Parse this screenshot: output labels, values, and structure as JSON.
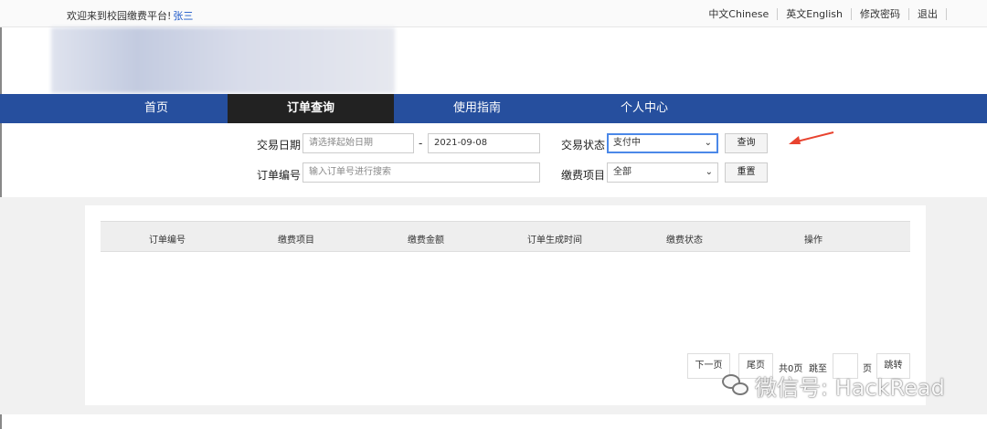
{
  "topbar": {
    "welcome": "欢迎来到校园缴费平台!",
    "username": "张三",
    "links": [
      "中文Chinese",
      "英文English",
      "修改密码",
      "退出"
    ]
  },
  "nav": {
    "items": [
      "首页",
      "订单查询",
      "使用指南",
      "个人中心"
    ],
    "active": "订单查询"
  },
  "search": {
    "date_label": "交易日期",
    "start_date_placeholder": "请选择起始日期",
    "date_separator": "-",
    "end_date_value": "2021-09-08",
    "status_label": "交易状态",
    "status_value": "支付中",
    "query_button": "查询",
    "order_label": "订单编号",
    "order_placeholder": "输入订单号进行搜索",
    "item_label": "缴费项目",
    "item_value": "全部",
    "reset_button": "重置"
  },
  "table": {
    "columns": [
      "订单编号",
      "缴费项目",
      "缴费金额",
      "订单生成时间",
      "缴费状态",
      "操作"
    ],
    "rows": []
  },
  "pager": {
    "next": "下一页",
    "last": "尾页",
    "total": "共0页",
    "goto": "跳至",
    "page_unit": "页",
    "jump": "跳转"
  },
  "watermark": {
    "text": "微信号: HackRead"
  },
  "colors": {
    "nav_bg": "#264f9e",
    "nav_active_bg": "#222222",
    "arrow": "#e8432f",
    "link": "#1a56c8"
  }
}
